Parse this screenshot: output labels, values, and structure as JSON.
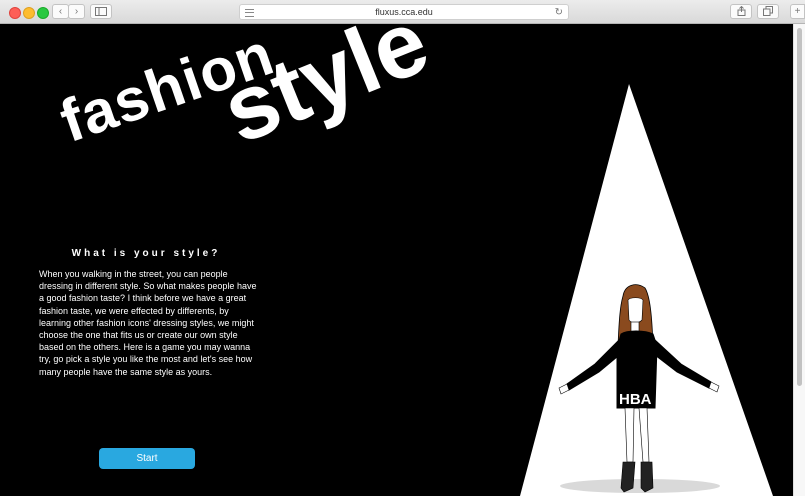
{
  "browser": {
    "url": "fluxus.cca.edu"
  },
  "hero": {
    "title_word_1": "fashion",
    "title_word_2": "style"
  },
  "content": {
    "question": "What is your style?",
    "paragraph": "When you walking in the street, you can people dressing in different style. So what makes people have a good fashion taste? I think before we have a great fashion taste, we were effected by differents, by learning other fashion icons' dressing styles, we might choose the one that fits us or create our own style based on the others. Here is a game you may wanna try, go pick a style you like the most and let's see how many people have the same style as yours.",
    "start_label": "Start"
  },
  "figure": {
    "shirt_text": "HBA"
  },
  "colors": {
    "background": "#000000",
    "button": "#29a8e0",
    "spotlight": "#ffffff"
  }
}
